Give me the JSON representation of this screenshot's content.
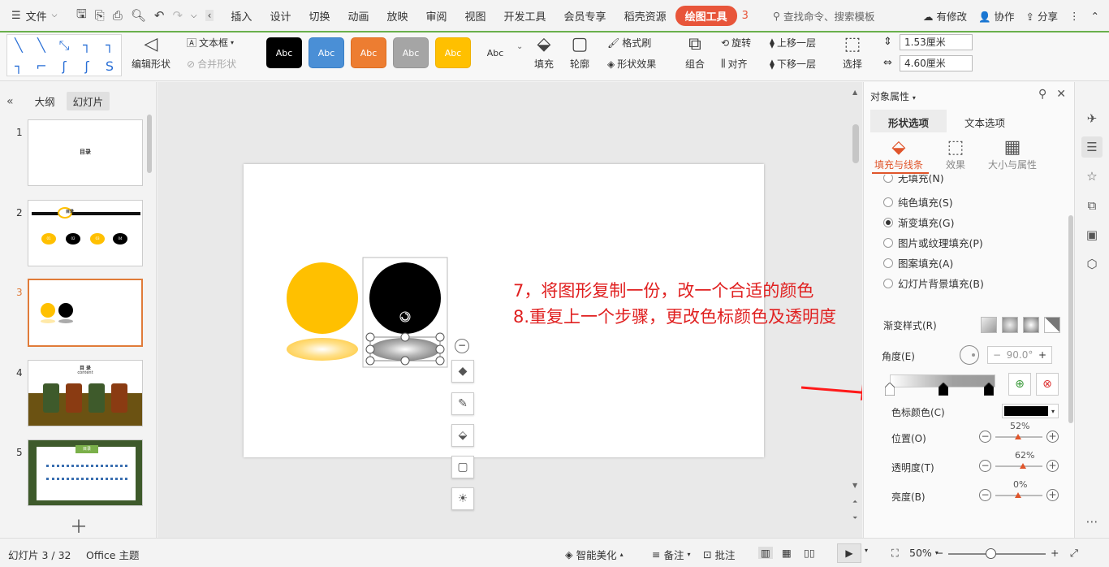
{
  "menu": {
    "file_label": "文件",
    "tabs": [
      "插入",
      "设计",
      "切换",
      "动画",
      "放映",
      "审阅",
      "视图",
      "开发工具",
      "会员专享",
      "稻壳资源"
    ],
    "active_tab": "绘图工具",
    "next_tab_hint": "3",
    "search_placeholder": "查找命令、搜索模板",
    "modified": "有修改",
    "collab": "协作",
    "share": "分享"
  },
  "ribbon": {
    "edit_shape": "编辑形状",
    "textbox": "文本框",
    "merge_shape": "合并形状",
    "styles": [
      {
        "label": "Abc",
        "bg": "#ffffff",
        "fg": "#333333",
        "border": "#6ab04c"
      },
      {
        "label": "Abc",
        "bg": "#000000",
        "fg": "#ffffff",
        "border": "#000000"
      },
      {
        "label": "Abc",
        "bg": "#4a8fd6",
        "fg": "#ffffff",
        "border": "#3a7fc6"
      },
      {
        "label": "Abc",
        "bg": "#ed7d31",
        "fg": "#ffffff",
        "border": "#dd6d21"
      },
      {
        "label": "Abc",
        "bg": "#a5a5a5",
        "fg": "#ffffff",
        "border": "#959595"
      },
      {
        "label": "Abc",
        "bg": "#ffc000",
        "fg": "#ffffff",
        "border": "#efb000"
      }
    ],
    "fill": "填充",
    "outline": "轮廓",
    "format_painter": "格式刷",
    "shape_effect": "形状效果",
    "group": "组合",
    "rotate": "旋转",
    "align": "对齐",
    "bring_forward": "上移一层",
    "send_backward": "下移一层",
    "select": "选择",
    "height": "1.53厘米",
    "width": "4.60厘米"
  },
  "left_pane": {
    "tab_outline": "大纲",
    "tab_slides": "幻灯片",
    "slides": [
      {
        "num": "1",
        "title": "目录"
      },
      {
        "num": "2",
        "title": "目录",
        "labels": [
          "01",
          "02",
          "03",
          "04"
        ]
      },
      {
        "num": "3",
        "title": ""
      },
      {
        "num": "4",
        "title": "目 录",
        "subtitle": "content"
      },
      {
        "num": "5",
        "title": "目录"
      }
    ]
  },
  "slide": {
    "annotation_line1": "7，将图形复制一份，改一个合适的颜色",
    "annotation_line2": "8.重复上一个步骤，更改色标颜色及透明度",
    "circle_colors": {
      "yellow": "#ffc000",
      "black": "#000000"
    }
  },
  "right_pane": {
    "title": "对象属性",
    "tab_shape": "形状选项",
    "tab_text": "文本选项",
    "sub_fill_line": "填充与线条",
    "sub_effect": "效果",
    "sub_size": "大小与属性",
    "fill_options": [
      {
        "label": "无填充(N)",
        "checked": false
      },
      {
        "label": "纯色填充(S)",
        "checked": false
      },
      {
        "label": "渐变填充(G)",
        "checked": true
      },
      {
        "label": "图片或纹理填充(P)",
        "checked": false
      },
      {
        "label": "图案填充(A)",
        "checked": false
      },
      {
        "label": "幻灯片背景填充(B)",
        "checked": false
      }
    ],
    "gradient_style_label": "渐变样式(R)",
    "angle_label": "角度(E)",
    "angle_value": "90.0°",
    "stop_color_label": "色标颜色(C)",
    "position_label": "位置(O)",
    "position_value": "52%",
    "transparency_label": "透明度(T)",
    "transparency_value": "62%",
    "brightness_label": "亮度(B)",
    "brightness_value": "0%",
    "stop_color": "#000000"
  },
  "status": {
    "slide_count": "幻灯片 3 / 32",
    "theme": "Office 主题",
    "beautify": "智能美化",
    "notes": "备注",
    "comment": "批注",
    "zoom": "50%"
  }
}
